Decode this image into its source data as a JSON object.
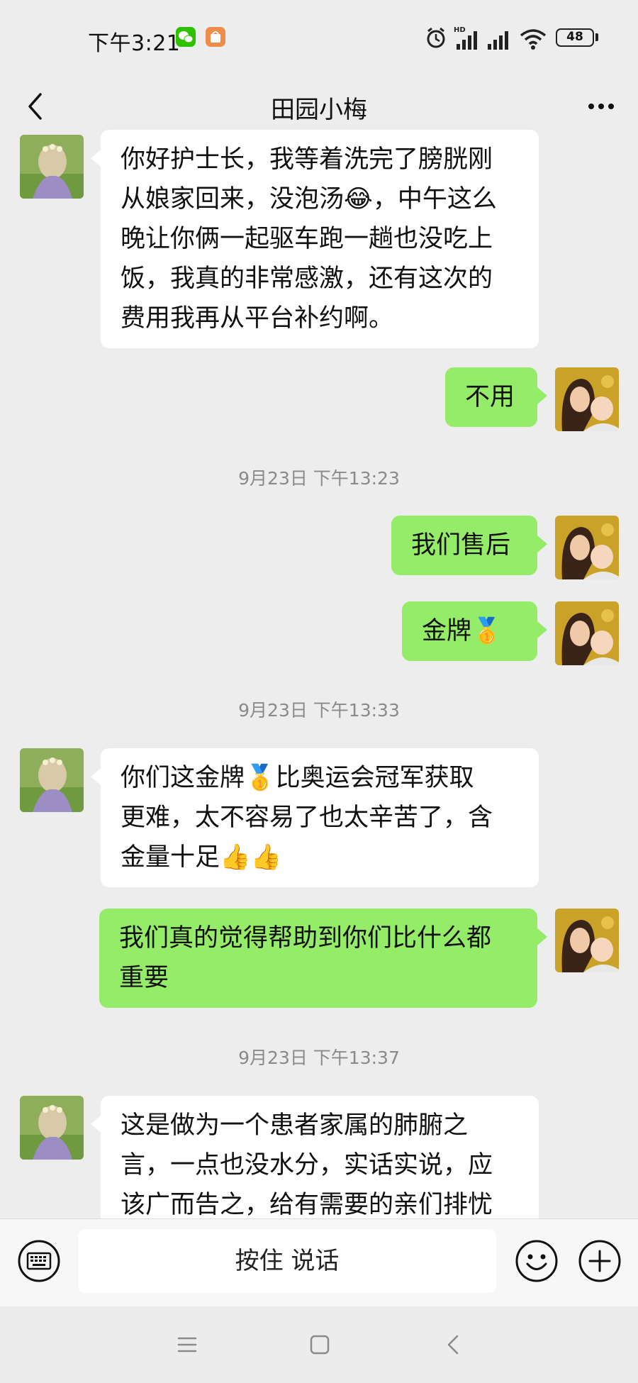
{
  "status_bar": {
    "time": "下午3:21",
    "battery": "48",
    "icons": [
      "wechat-notification-icon",
      "store-notification-icon",
      "alarm-icon",
      "hd-signal-icon",
      "signal-icon",
      "wifi-icon",
      "battery-icon"
    ]
  },
  "header": {
    "title": "田园小梅",
    "back_icon": "chevron-left-icon",
    "more_icon": "more-dots-icon"
  },
  "messages": [
    {
      "side": "left",
      "text": "你好护士长，我等着洗完了膀胱刚\n从娘家回来，没泡汤😂，中午这么\n晚让你俩一起驱车跑一趟也没吃上\n饭，我真的非常感激，还有这次的\n费用我再从平台补约啊。"
    },
    {
      "side": "right",
      "text": "不用"
    },
    {
      "type": "time",
      "text": "9月23日 下午13:23"
    },
    {
      "side": "right",
      "text": "我们售后"
    },
    {
      "side": "right",
      "text": "金牌🥇"
    },
    {
      "type": "time",
      "text": "9月23日 下午13:33"
    },
    {
      "side": "left",
      "text": "你们这金牌🥇比奥运会冠军获取\n更难，太不容易了也太辛苦了，含\n金量十足👍👍"
    },
    {
      "side": "right",
      "text": "我们真的觉得帮助到你们比什么都\n重要"
    },
    {
      "type": "time",
      "text": "9月23日 下午13:37"
    },
    {
      "side": "left",
      "text": "这是做为一个患者家属的肺腑之\n言，一点也没水分，实话实说，应\n该广而告之，给有需要的亲们排忧"
    }
  ],
  "input_bar": {
    "hold_to_talk": "按住 说话",
    "keyboard_icon": "keyboard-icon",
    "emoji_icon": "emoji-icon",
    "plus_icon": "plus-icon"
  },
  "system_nav": {
    "menu_icon": "menu-icon",
    "home_icon": "home-icon",
    "back_icon": "back-icon"
  },
  "colors": {
    "background": "#ededed",
    "sent_bubble": "#95ec69",
    "received_bubble": "#ffffff",
    "timestamp": "#8a8a8a"
  }
}
